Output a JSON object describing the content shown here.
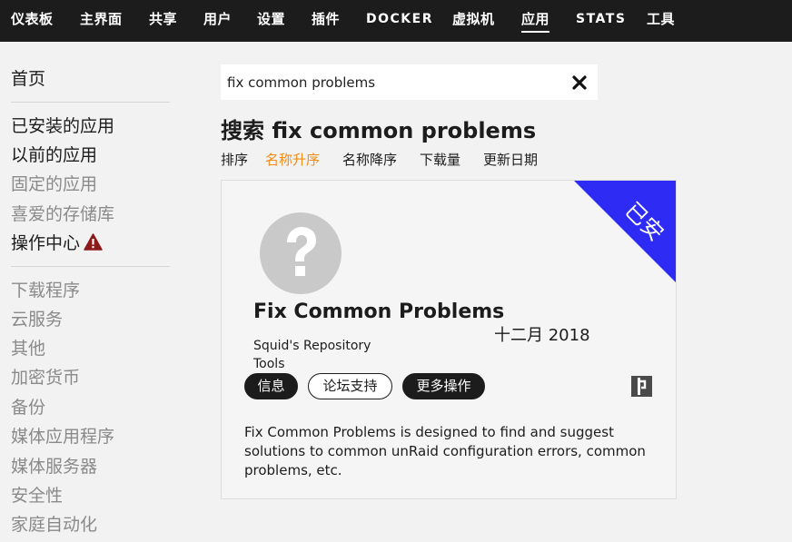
{
  "nav": {
    "items": [
      {
        "label": "仪表板"
      },
      {
        "label": "主界面"
      },
      {
        "label": "共享"
      },
      {
        "label": "用户"
      },
      {
        "label": "设置"
      },
      {
        "label": "插件"
      },
      {
        "label": "DOCKER"
      },
      {
        "label": "虚拟机"
      },
      {
        "label": "应用",
        "active": true
      },
      {
        "label": "STATS"
      },
      {
        "label": "工具"
      }
    ]
  },
  "sidebar": {
    "items": [
      {
        "label": "首页"
      },
      {
        "label": "已安装的应用"
      },
      {
        "label": "以前的应用"
      },
      {
        "label": "固定的应用"
      },
      {
        "label": "喜爱的存储库"
      },
      {
        "label": "操作中心",
        "icon": "warning-icon"
      },
      {
        "label": "下载程序"
      },
      {
        "label": "云服务"
      },
      {
        "label": "其他"
      },
      {
        "label": "加密货币"
      },
      {
        "label": "备份"
      },
      {
        "label": "媒体应用程序"
      },
      {
        "label": "媒体服务器"
      },
      {
        "label": "安全性"
      },
      {
        "label": "家庭自动化"
      }
    ]
  },
  "search": {
    "value": "fix common problems",
    "title": "搜索 fix common problems",
    "clear_icon": "close-icon"
  },
  "sort": {
    "label": "排序",
    "options": [
      {
        "label": "名称升序",
        "active": true
      },
      {
        "label": "名称降序"
      },
      {
        "label": "下载量"
      },
      {
        "label": "更新日期"
      }
    ]
  },
  "app_card": {
    "name": "Fix Common Problems",
    "date": "十二月 2018",
    "repository": "Squid's Repository",
    "category": "Tools",
    "ribbon": "已安",
    "icon": "question-mark-icon",
    "buttons": {
      "info": "信息",
      "forum": "论坛支持",
      "more": "更多操作"
    },
    "support_icon": "unraid-support-icon",
    "description": "Fix Common Problems is designed to find and suggest solutions to common unRaid configuration errors, common problems, etc."
  },
  "colors": {
    "nav_bg": "#1c1c1c",
    "page_bg": "#f2f2f2",
    "accent_orange": "#f28c14",
    "ribbon_blue": "#2e2bf5",
    "warning_red": "#8b1a1a"
  }
}
